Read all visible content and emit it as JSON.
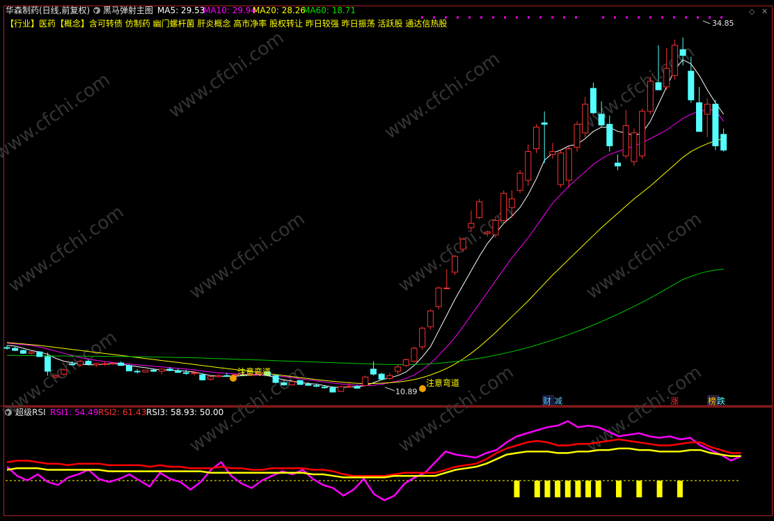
{
  "header": {
    "stock_title": "华森制药(日线,前复权)",
    "indicator_name": "黑马弹射主图",
    "ma5_label": "MA5: 29.53",
    "ma10_label": "MA10: 29.94",
    "ma20_label": "MA20: 28.26",
    "ma60_label": "MA60: 18.71"
  },
  "tags_line": "【行业】医药【概念】含可转债 仿制药 幽门螺杆菌 肝炎概念 高市净率 股权转让 昨日较强 昨日振荡 活跃股 通达信热股",
  "annotations": {
    "high_label": "34.85",
    "low_label": "10.89",
    "signal_1": "注意弯道",
    "signal_2": "注意弯道",
    "event_1": "财",
    "event_2": "减",
    "event_3": "涨",
    "event_4": "榜",
    "event_5": "跌"
  },
  "watermark": "www.cfchi.com",
  "sub_panel": {
    "name": "超级RSI",
    "rsi1_label": "RSI1: 54.49",
    "rsi2_label": "RSI2: 61.43",
    "rsi3_label": "RSI3: 58.93",
    "level_label": ": 50.00"
  },
  "colors": {
    "up": "#ff3232",
    "down": "#54ffff",
    "ma5": "#ffffff",
    "ma10": "#ff00ff",
    "ma20": "#ffff00",
    "ma60": "#00c800",
    "rsi1": "#ff00ff",
    "rsi2": "#ff0000",
    "rsi3": "#ffff00"
  },
  "chart_data": [
    {
      "type": "candlestick",
      "title": "黑马弹射主图",
      "price_range": [
        10.0,
        36.0
      ],
      "candles": [
        [
          13.25,
          13.4,
          13.1,
          13.2
        ],
        [
          13.2,
          13.3,
          13.0,
          13.05
        ],
        [
          13.05,
          13.1,
          12.8,
          12.85
        ],
        [
          12.85,
          13.0,
          12.75,
          12.95
        ],
        [
          12.95,
          13.0,
          12.6,
          12.62
        ],
        [
          12.62,
          12.9,
          11.3,
          11.6
        ],
        [
          11.2,
          11.4,
          11.1,
          11.3
        ],
        [
          11.4,
          11.8,
          11.3,
          11.7
        ],
        [
          12.1,
          12.3,
          12.0,
          12.05
        ],
        [
          12.05,
          12.4,
          11.95,
          12.3
        ],
        [
          12.3,
          12.4,
          12.0,
          12.1
        ],
        [
          12.05,
          12.2,
          11.9,
          12.15
        ],
        [
          12.1,
          12.3,
          12.0,
          12.12
        ],
        [
          12.12,
          12.25,
          12.05,
          12.18
        ],
        [
          12.18,
          12.3,
          12.0,
          12.0
        ],
        [
          12.0,
          12.1,
          11.6,
          11.62
        ],
        [
          11.6,
          11.75,
          11.45,
          11.55
        ],
        [
          11.55,
          11.7,
          11.5,
          11.68
        ],
        [
          11.68,
          11.8,
          11.55,
          11.6
        ],
        [
          11.6,
          11.8,
          11.4,
          11.75
        ],
        [
          11.75,
          11.9,
          11.6,
          11.65
        ],
        [
          11.65,
          11.8,
          11.5,
          11.52
        ],
        [
          11.5,
          11.7,
          11.35,
          11.45
        ],
        [
          11.45,
          11.6,
          11.3,
          11.5
        ],
        [
          11.35,
          11.45,
          10.95,
          11.0
        ],
        [
          11.05,
          11.3,
          10.95,
          11.22
        ],
        [
          11.22,
          11.4,
          11.15,
          11.3
        ],
        [
          11.3,
          11.5,
          11.2,
          11.28
        ],
        [
          11.3,
          11.45,
          11.2,
          11.35
        ],
        [
          11.35,
          11.5,
          11.25,
          11.32
        ],
        [
          11.32,
          11.45,
          11.25,
          11.4
        ],
        [
          11.4,
          11.55,
          11.3,
          11.52
        ],
        [
          11.55,
          11.6,
          11.25,
          11.3
        ],
        [
          11.3,
          11.4,
          10.75,
          10.82
        ],
        [
          10.8,
          10.95,
          10.6,
          10.65
        ],
        [
          10.65,
          10.95,
          10.6,
          10.88
        ],
        [
          10.95,
          11.0,
          10.65,
          10.68
        ],
        [
          10.7,
          10.85,
          10.6,
          10.62
        ],
        [
          10.6,
          10.75,
          10.5,
          10.55
        ],
        [
          10.5,
          10.6,
          10.4,
          10.45
        ],
        [
          10.45,
          10.55,
          10.12,
          10.15
        ],
        [
          10.2,
          10.6,
          10.15,
          10.52
        ],
        [
          10.5,
          10.9,
          10.45,
          10.55
        ],
        [
          10.55,
          10.65,
          10.4,
          10.42
        ],
        [
          10.6,
          11.3,
          10.55,
          11.2
        ],
        [
          11.75,
          12.3,
          11.3,
          11.4
        ],
        [
          11.4,
          11.5,
          11.0,
          11.05
        ],
        [
          11.1,
          11.5,
          11.0,
          11.3
        ],
        [
          11.6,
          12.1,
          11.4,
          11.9
        ],
        [
          12.0,
          12.5,
          11.9,
          12.4
        ],
        [
          12.3,
          13.3,
          12.2,
          13.2
        ],
        [
          13.3,
          14.7,
          13.1,
          14.6
        ],
        [
          14.7,
          15.9,
          14.5,
          15.8
        ],
        [
          16.1,
          17.5,
          15.9,
          17.4
        ],
        [
          17.4,
          18.7,
          17.3,
          17.4
        ],
        [
          18.5,
          19.7,
          18.3,
          19.6
        ],
        [
          20.1,
          20.9,
          19.9,
          20.8
        ],
        [
          21.6,
          22.8,
          21.3,
          21.9
        ],
        [
          22.3,
          23.6,
          22.2,
          23.4
        ],
        [
          21.2,
          21.4,
          21.0,
          21.3
        ],
        [
          21.1,
          22.4,
          20.9,
          22.1
        ],
        [
          22.1,
          24.2,
          21.9,
          24.0
        ],
        [
          23.0,
          24.2,
          22.3,
          23.6
        ],
        [
          24.2,
          25.6,
          24.0,
          25.4
        ],
        [
          24.9,
          27.4,
          24.5,
          26.9
        ],
        [
          27.1,
          28.8,
          26.8,
          28.6
        ],
        [
          28.9,
          29.7,
          26.1,
          28.8
        ],
        [
          26.7,
          27.5,
          26.4,
          26.9
        ],
        [
          24.6,
          27.0,
          24.4,
          26.8
        ],
        [
          24.9,
          27.3,
          24.4,
          27.1
        ],
        [
          27.2,
          29.0,
          26.9,
          28.8
        ],
        [
          28.2,
          30.7,
          27.9,
          30.2
        ],
        [
          31.3,
          31.7,
          29.5,
          29.6
        ],
        [
          29.5,
          30.4,
          28.6,
          28.75
        ],
        [
          28.8,
          29.4,
          26.9,
          27.3
        ],
        [
          26.1,
          26.7,
          25.6,
          25.9
        ],
        [
          26.6,
          29.8,
          26.4,
          28.7
        ],
        [
          26.2,
          28.5,
          25.9,
          28.2
        ],
        [
          26.6,
          29.9,
          26.4,
          29.7
        ],
        [
          29.7,
          32.1,
          29.5,
          31.8
        ],
        [
          31.7,
          34.3,
          31.5,
          31.2
        ],
        [
          31.4,
          34.1,
          31.2,
          32.7
        ],
        [
          32.2,
          34.7,
          31.9,
          34.3
        ],
        [
          34.0,
          34.85,
          32.9,
          33.6
        ],
        [
          32.5,
          33.5,
          30.3,
          30.5
        ],
        [
          30.3,
          31.4,
          28.4,
          28.3
        ],
        [
          29.5,
          30.6,
          27.9,
          30.2
        ],
        [
          30.2,
          30.5,
          27.0,
          27.3
        ],
        [
          28.1,
          28.5,
          26.9,
          27.0
        ]
      ],
      "series": [
        {
          "name": "MA5",
          "values": [
            13.4,
            13.35,
            13.2,
            13.05,
            12.95,
            12.78,
            12.5,
            12.3,
            12.2,
            12.1,
            12.05,
            12.05,
            12.1,
            12.12,
            12.1,
            12.0,
            11.92,
            11.85,
            11.75,
            11.7,
            11.68,
            11.65,
            11.6,
            11.55,
            11.42,
            11.3,
            11.25,
            11.25,
            11.25,
            11.3,
            11.32,
            11.35,
            11.3,
            11.15,
            11.0,
            10.92,
            10.82,
            10.75,
            10.7,
            10.6,
            10.5,
            10.48,
            10.5,
            10.52,
            10.6,
            10.8,
            11.0,
            11.15,
            11.3,
            11.55,
            12.0,
            12.6,
            13.3,
            14.4,
            15.5,
            16.6,
            17.6,
            18.6,
            19.6,
            20.5,
            21.2,
            21.9,
            22.4,
            23.0,
            23.9,
            25.0,
            26.3,
            26.8,
            27.0,
            27.3,
            27.4,
            27.8,
            28.3,
            28.6,
            28.6,
            28.3,
            28.2,
            28.0,
            28.2,
            29.0,
            30.2,
            31.4,
            32.6,
            33.3,
            33.0,
            32.2,
            31.2,
            30.3,
            29.5
          ]
        },
        {
          "name": "MA10",
          "values": [
            13.55,
            13.5,
            13.45,
            13.4,
            13.3,
            13.15,
            13.0,
            12.85,
            12.7,
            12.55,
            12.45,
            12.35,
            12.28,
            12.22,
            12.16,
            12.1,
            12.05,
            12.0,
            11.95,
            11.9,
            11.85,
            11.8,
            11.75,
            11.7,
            11.62,
            11.55,
            11.5,
            11.45,
            11.42,
            11.4,
            11.38,
            11.35,
            11.32,
            11.28,
            11.22,
            11.15,
            11.08,
            11.0,
            10.93,
            10.85,
            10.78,
            10.72,
            10.67,
            10.63,
            10.6,
            10.62,
            10.7,
            10.8,
            10.92,
            11.1,
            11.35,
            11.7,
            12.15,
            12.7,
            13.3,
            13.95,
            14.7,
            15.5,
            16.3,
            17.1,
            17.9,
            18.7,
            19.5,
            20.2,
            20.9,
            21.7,
            22.5,
            23.3,
            23.9,
            24.5,
            25.0,
            25.5,
            26.0,
            26.4,
            26.7,
            26.9,
            27.1,
            27.3,
            27.5,
            27.8,
            28.1,
            28.4,
            28.8,
            29.2,
            29.5,
            29.7,
            29.8,
            29.8,
            29.0
          ]
        },
        {
          "name": "MA20",
          "values": [
            13.6,
            13.55,
            13.5,
            13.45,
            13.4,
            13.33,
            13.26,
            13.19,
            13.12,
            13.05,
            12.98,
            12.91,
            12.84,
            12.77,
            12.7,
            12.63,
            12.56,
            12.49,
            12.42,
            12.35,
            12.28,
            12.21,
            12.14,
            12.07,
            12.0,
            11.93,
            11.86,
            11.79,
            11.72,
            11.65,
            11.58,
            11.51,
            11.44,
            11.37,
            11.3,
            11.23,
            11.16,
            11.09,
            11.02,
            10.96,
            10.9,
            10.85,
            10.8,
            10.76,
            10.74,
            10.75,
            10.77,
            10.8,
            10.85,
            10.92,
            11.02,
            11.16,
            11.34,
            11.55,
            11.8,
            12.1,
            12.45,
            12.85,
            13.3,
            13.8,
            14.3,
            14.85,
            15.4,
            15.95,
            16.5,
            17.1,
            17.7,
            18.3,
            18.85,
            19.4,
            19.95,
            20.5,
            21.05,
            21.6,
            22.1,
            22.6,
            23.1,
            23.6,
            24.05,
            24.5,
            25.0,
            25.5,
            26.0,
            26.5,
            26.9,
            27.2,
            27.45,
            27.65,
            27.8
          ]
        },
        {
          "name": "MA60",
          "values": [
            12.7,
            12.7,
            12.69,
            12.69,
            12.68,
            12.68,
            12.67,
            12.67,
            12.66,
            12.66,
            12.65,
            12.65,
            12.64,
            12.64,
            12.63,
            12.62,
            12.61,
            12.6,
            12.59,
            12.58,
            12.57,
            12.56,
            12.55,
            12.54,
            12.52,
            12.5,
            12.48,
            12.46,
            12.44,
            12.42,
            12.4,
            12.38,
            12.36,
            12.34,
            12.32,
            12.3,
            12.28,
            12.26,
            12.24,
            12.22,
            12.2,
            12.18,
            12.16,
            12.14,
            12.12,
            12.1,
            12.08,
            12.07,
            12.06,
            12.06,
            12.07,
            12.09,
            12.12,
            12.16,
            12.21,
            12.27,
            12.34,
            12.42,
            12.51,
            12.61,
            12.72,
            12.84,
            12.97,
            13.11,
            13.26,
            13.42,
            13.59,
            13.77,
            13.96,
            14.16,
            14.37,
            14.59,
            14.82,
            15.06,
            15.31,
            15.57,
            15.84,
            16.12,
            16.41,
            16.71,
            17.02,
            17.34,
            17.67,
            18.0,
            18.2,
            18.4,
            18.55,
            18.65,
            18.71
          ]
        }
      ]
    },
    {
      "type": "line",
      "title": "超级RSI",
      "ylim": [
        20,
        85
      ],
      "level": 50,
      "series": [
        {
          "name": "RSI1",
          "values": [
            52,
            46,
            43,
            47,
            42,
            40,
            45,
            47,
            50,
            44,
            42,
            44,
            47,
            43,
            39,
            48,
            44,
            42,
            37,
            42,
            50,
            55,
            46,
            41,
            38,
            43,
            46,
            49,
            47,
            50,
            44,
            40,
            38,
            33,
            37,
            44,
            34,
            30,
            33,
            41,
            45,
            48,
            55,
            62,
            60,
            59,
            58,
            61,
            63,
            68,
            72,
            74,
            76,
            78,
            79,
            82,
            78,
            79,
            78,
            75,
            72,
            73,
            74,
            72,
            71,
            72,
            70,
            71,
            66,
            63,
            60,
            56,
            59
          ]
        },
        {
          "name": "RSI2",
          "values": [
            55,
            56,
            56,
            55,
            54,
            54,
            53,
            54,
            54,
            54,
            53,
            53,
            53,
            53,
            52,
            53,
            52,
            52,
            51,
            51,
            51,
            52,
            51,
            51,
            50,
            50,
            51,
            51,
            51,
            51,
            50,
            50,
            49,
            47,
            46,
            46,
            46,
            46,
            47,
            48,
            48,
            48,
            48,
            50,
            52,
            53,
            54,
            57,
            61,
            64,
            66,
            68,
            69,
            68,
            66,
            66,
            67,
            67,
            68,
            69,
            70,
            69,
            68,
            67,
            66,
            66,
            67,
            68,
            68,
            65,
            63,
            61,
            61
          ]
        },
        {
          "name": "RSI3",
          "values": [
            50,
            51,
            51,
            51,
            50,
            50,
            50,
            50,
            50,
            50,
            49,
            49,
            49,
            49,
            49,
            49,
            49,
            49,
            49,
            49,
            48,
            48,
            48,
            48,
            48,
            48,
            48,
            48,
            48,
            48,
            47,
            47,
            46,
            45,
            45,
            45,
            45,
            45,
            46,
            46,
            46,
            46,
            46,
            48,
            50,
            51,
            52,
            54,
            57,
            60,
            61,
            62,
            62,
            62,
            61,
            61,
            62,
            62,
            63,
            63,
            64,
            64,
            63,
            63,
            62,
            62,
            62,
            63,
            63,
            61,
            60,
            59,
            59
          ]
        }
      ]
    }
  ]
}
